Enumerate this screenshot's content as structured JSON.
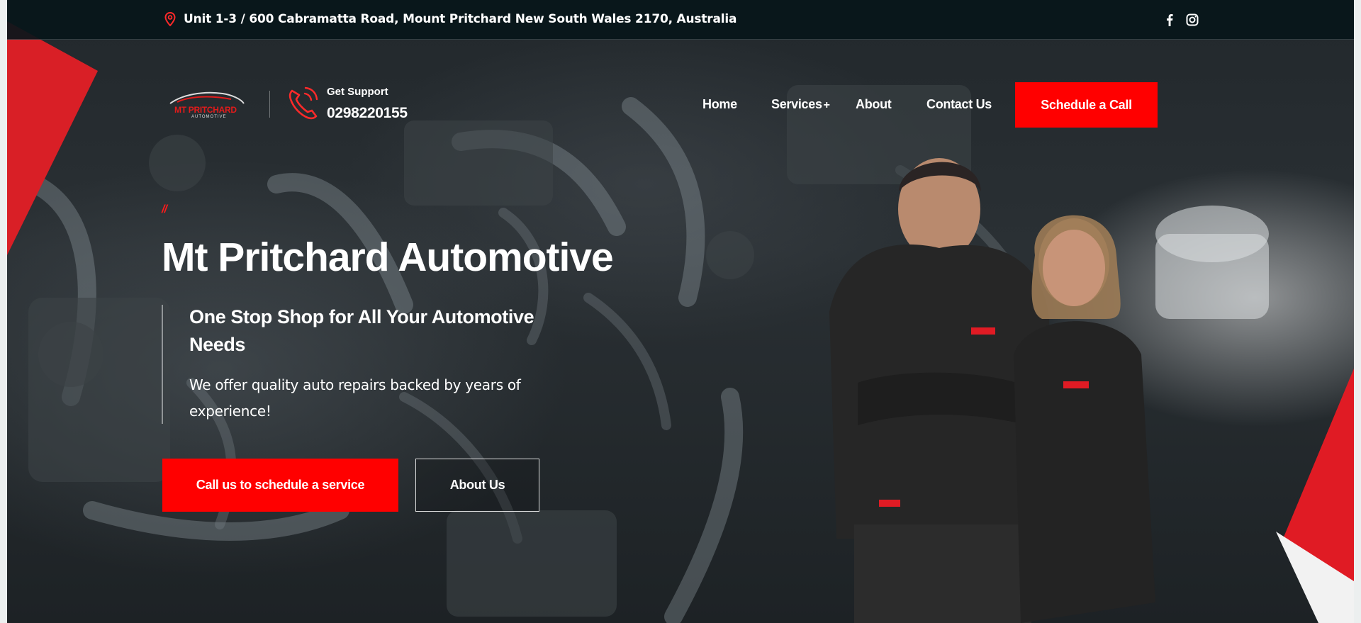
{
  "topbar": {
    "address": "Unit 1-3 / 600 Cabramatta Road, Mount Pritchard New South Wales 2170, Australia",
    "location_icon": "map-pin-icon",
    "social": [
      "facebook-icon",
      "instagram-icon"
    ]
  },
  "header": {
    "logo_text": "MT PRITCHARD",
    "logo_sub": "AUTOMOTIVE",
    "support_label": "Get Support",
    "support_number": "0298220155",
    "phone_icon": "phone-ringing-icon",
    "nav": {
      "home": "Home",
      "services": "Services",
      "services_suffix": "+",
      "about": "About",
      "contact": "Contact Us"
    },
    "cta": "Schedule a Call"
  },
  "hero": {
    "slashes": "//",
    "title": "Mt Pritchard Automotive",
    "subtitle": "One Stop Shop for All Your Automotive Needs",
    "description": "We offer quality auto repairs backed by years of experience!",
    "primary_button": "Call us to schedule a service",
    "secondary_button": "About Us"
  },
  "colors": {
    "accent": "#ff0000",
    "topbar_bg": "#08161a",
    "text": "#ffffff"
  }
}
